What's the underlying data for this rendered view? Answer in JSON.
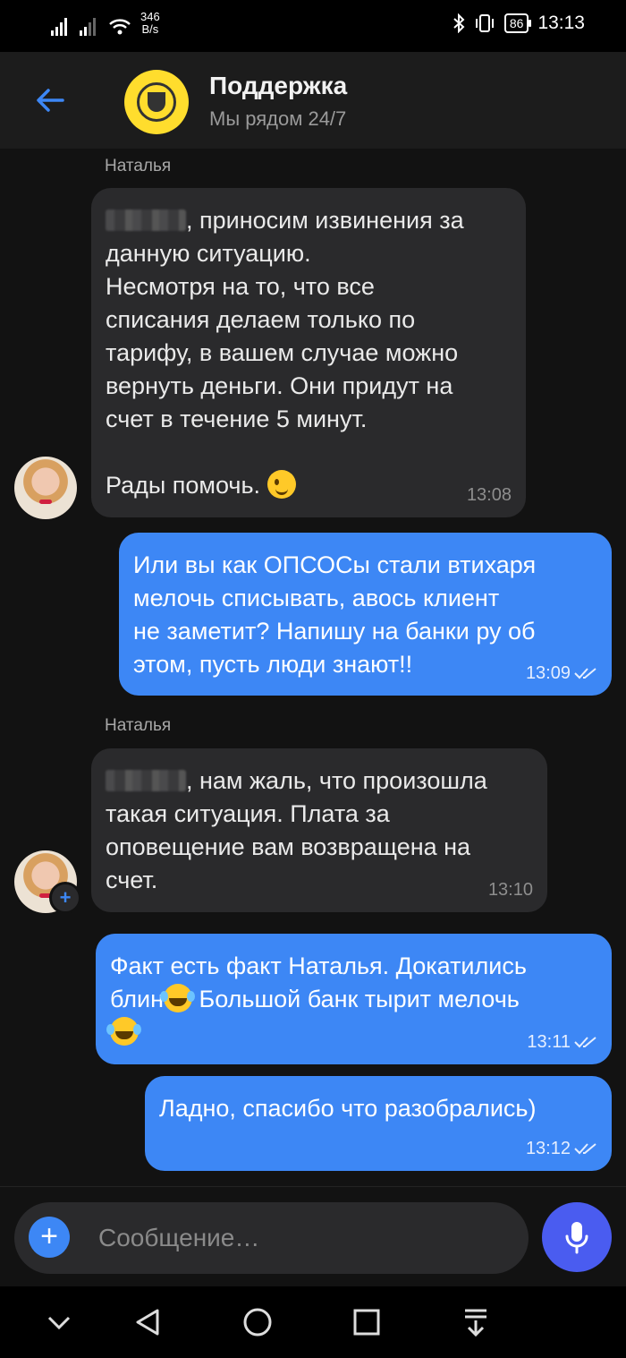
{
  "status_bar": {
    "net_speed_value": "346",
    "net_speed_unit": "B/s",
    "battery": "86",
    "time": "13:13"
  },
  "header": {
    "back_icon": "arrow-left-icon",
    "title": "Поддержка",
    "subtitle": "Мы рядом 24/7",
    "accent": "#3d87f5",
    "logo_color": "#ffdd2d"
  },
  "messages": [
    {
      "from": "Наталья",
      "direction": "in",
      "lines": [
        ", приносим извинения за",
        "данную ситуацию.",
        "Несмотря на то, что все",
        "списания делаем только по",
        "тарифу, в вашем случае можно",
        "вернуть деньги. Они придут на",
        "счет в течение 5 минут."
      ],
      "closing": "Рады помочь.",
      "time": "13:08"
    },
    {
      "direction": "out",
      "lines": [
        "Или вы как ОПСОСы стали втихаря",
        "мелочь списывать, авось клиент",
        "не заметит? Напишу на банки ру об",
        "этом, пусть люди знают!!"
      ],
      "time": "13:09"
    },
    {
      "from": "Наталья",
      "direction": "in",
      "lines": [
        ", нам жаль, что произошла",
        "такая ситуация. Плата за",
        "оповещение вам возвращена на",
        "счет."
      ],
      "time": "13:10"
    },
    {
      "direction": "out",
      "lines": [
        "Факт есть факт Наталья. Докатились",
        "блин",
        " Большой банк тырит мелочь"
      ],
      "time": "13:11"
    },
    {
      "direction": "out",
      "lines": [
        "Ладно, спасибо что разобрались)"
      ],
      "time": "13:12"
    }
  ],
  "composer": {
    "placeholder": "Сообщение…"
  },
  "colors": {
    "incoming_bubble": "#2a2a2c",
    "outgoing_bubble": "#3d87f5",
    "mic_button": "#4a5cf0",
    "background": "#121212"
  }
}
